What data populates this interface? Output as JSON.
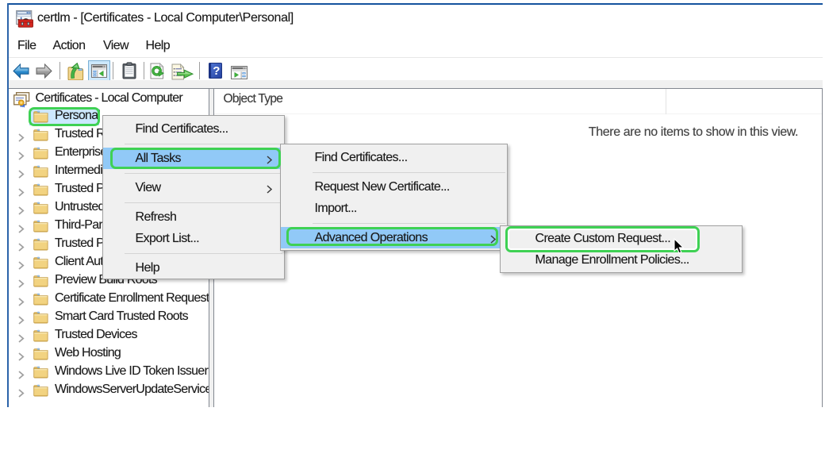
{
  "window": {
    "title": "certlm - [Certificates - Local Computer\\Personal]",
    "app_icon": "mmc-console-icon"
  },
  "menubar": {
    "items": [
      {
        "label": "File"
      },
      {
        "label": "Action"
      },
      {
        "label": "View"
      },
      {
        "label": "Help"
      }
    ]
  },
  "toolbar": {
    "buttons": [
      {
        "name": "back-button",
        "icon": "back-arrow-icon"
      },
      {
        "name": "forward-button",
        "icon": "forward-arrow-icon"
      },
      {
        "name": "up-one-level-button",
        "icon": "folder-up-icon"
      },
      {
        "name": "show-hide-console-tree-button",
        "icon": "console-tree-icon",
        "pressed": true
      },
      {
        "name": "properties-button",
        "icon": "clipboard-icon"
      },
      {
        "name": "refresh-button",
        "icon": "refresh-icon"
      },
      {
        "name": "export-list-button",
        "icon": "export-list-icon"
      },
      {
        "name": "help-button",
        "icon": "help-icon"
      },
      {
        "name": "show-hide-action-pane-button",
        "icon": "action-pane-icon"
      }
    ]
  },
  "tree": {
    "root": {
      "label": "Certificates - Local Computer",
      "icon": "certificates-snapin-icon"
    },
    "items": [
      {
        "label": "Personal",
        "expandable": false,
        "selected": true
      },
      {
        "label": "Trusted Root Certification Authorities",
        "expandable": true
      },
      {
        "label": "Enterprise Trust",
        "expandable": true
      },
      {
        "label": "Intermediate Certification Authorities",
        "expandable": true
      },
      {
        "label": "Trusted Publishers",
        "expandable": true
      },
      {
        "label": "Untrusted Certificates",
        "expandable": true
      },
      {
        "label": "Third-Party Root Certification Authorities",
        "expandable": true
      },
      {
        "label": "Trusted People",
        "expandable": true
      },
      {
        "label": "Client Authentication Issuers",
        "expandable": true
      },
      {
        "label": "Preview Build Roots",
        "expandable": true
      },
      {
        "label": "Certificate Enrollment Requests",
        "expandable": true
      },
      {
        "label": "Smart Card Trusted Roots",
        "expandable": true
      },
      {
        "label": "Trusted Devices",
        "expandable": true
      },
      {
        "label": "Web Hosting",
        "expandable": true
      },
      {
        "label": "Windows Live ID Token Issuer",
        "expandable": true
      },
      {
        "label": "WindowsServerUpdateServices",
        "expandable": true
      }
    ]
  },
  "view": {
    "column_header": "Object Type",
    "empty_message": "There are no items to show in this view."
  },
  "context_menu": {
    "items": [
      {
        "label": "Find Certificates...",
        "type": "item"
      },
      {
        "type": "separator"
      },
      {
        "label": "All Tasks",
        "type": "item",
        "submenu": true,
        "highlighted": true
      },
      {
        "type": "separator"
      },
      {
        "label": "View",
        "type": "item",
        "submenu": true
      },
      {
        "type": "separator"
      },
      {
        "label": "Refresh",
        "type": "item"
      },
      {
        "label": "Export List...",
        "type": "item"
      },
      {
        "type": "separator"
      },
      {
        "label": "Help",
        "type": "item"
      }
    ]
  },
  "all_tasks_menu": {
    "items": [
      {
        "label": "Find Certificates...",
        "type": "item"
      },
      {
        "type": "separator"
      },
      {
        "label": "Request New Certificate...",
        "type": "item"
      },
      {
        "label": "Import...",
        "type": "item"
      },
      {
        "type": "separator"
      },
      {
        "label": "Advanced Operations",
        "type": "item",
        "submenu": true,
        "highlighted": true
      }
    ]
  },
  "advanced_operations_menu": {
    "items": [
      {
        "label": "Create Custom Request...",
        "type": "item"
      },
      {
        "label": "Manage Enrollment Policies...",
        "type": "item"
      }
    ]
  },
  "annotations": {
    "color": "#3fd154",
    "boxes": [
      "personal-tree-item",
      "all-tasks-menu-item",
      "advanced-operations-menu-item",
      "create-custom-request-menu-item"
    ]
  },
  "colors": {
    "window_border": "#15539e",
    "menu_highlight": "#91c9f7",
    "selection": "#cce8ff",
    "menu_bg": "#f0f0f0",
    "panel_border": "#828790"
  }
}
